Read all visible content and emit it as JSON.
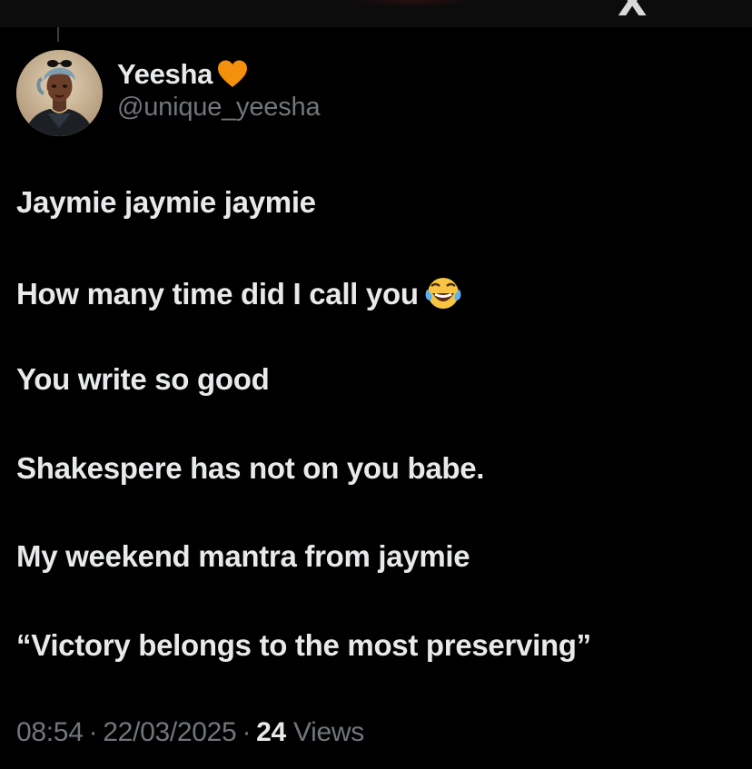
{
  "tweet": {
    "author": {
      "display_name": "Yeesha",
      "badge_icon": "orange-heart-icon",
      "handle": "@unique_yeesha"
    },
    "lines": [
      "Jaymie jaymie jaymie",
      "How many time did I call you",
      "You write so good",
      "Shakespere has not on you babe.",
      "My weekend mantra from jaymie",
      "“Victory belongs to the most preserving”"
    ],
    "emoji_after_line_2": "face-with-tears-of-joy-icon",
    "meta": {
      "time": "08:54",
      "separator": "·",
      "date": "22/03/2025",
      "views_count": "24",
      "views_label": "Views"
    }
  },
  "colors": {
    "background": "#000000",
    "primary_text": "#e7e9ea",
    "secondary_text": "#71767b",
    "heart": "#f4900c"
  }
}
